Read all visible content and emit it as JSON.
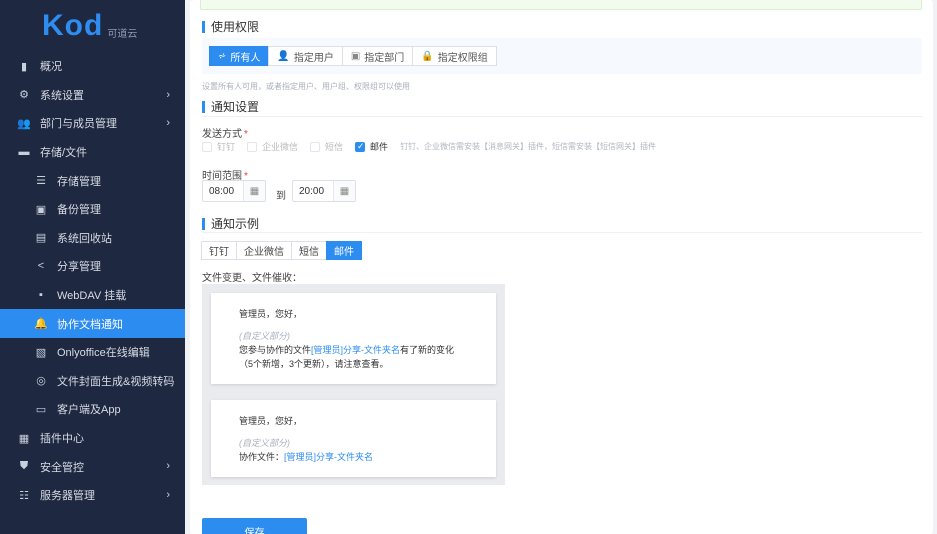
{
  "sidebar": {
    "brand": "Kod",
    "brand_sub": "可道云",
    "items": [
      {
        "label": "概况",
        "icon": "bar-chart-icon",
        "child": false,
        "chevron": false
      },
      {
        "label": "系统设置",
        "icon": "gear-icon",
        "child": false,
        "chevron": true
      },
      {
        "label": "部门与成员管理",
        "icon": "users-icon",
        "child": false,
        "chevron": true
      },
      {
        "label": "存储/文件",
        "icon": "folder-icon",
        "child": false,
        "chevron": false
      },
      {
        "label": "存储管理",
        "icon": "database-icon",
        "child": true,
        "chevron": false
      },
      {
        "label": "备份管理",
        "icon": "save-icon",
        "child": true,
        "chevron": false
      },
      {
        "label": "系统回收站",
        "icon": "trash-icon",
        "child": true,
        "chevron": false
      },
      {
        "label": "分享管理",
        "icon": "share-icon",
        "child": true,
        "chevron": false
      },
      {
        "label": "WebDAV 挂载",
        "icon": "drive-icon",
        "child": true,
        "chevron": false
      },
      {
        "label": "协作文档通知",
        "icon": "bell-icon",
        "child": true,
        "chevron": false,
        "active": true
      },
      {
        "label": "Onlyoffice在线编辑",
        "icon": "doc-edit-icon",
        "child": true,
        "chevron": false
      },
      {
        "label": "文件封面生成&视频转码",
        "icon": "media-icon",
        "child": true,
        "chevron": false
      },
      {
        "label": "客户端及App",
        "icon": "monitor-icon",
        "child": true,
        "chevron": false
      },
      {
        "label": "插件中心",
        "icon": "grid-icon",
        "child": false,
        "chevron": false
      },
      {
        "label": "安全管控",
        "icon": "shield-icon",
        "child": false,
        "chevron": true
      },
      {
        "label": "服务器管理",
        "icon": "server-icon",
        "child": false,
        "chevron": true
      }
    ]
  },
  "permission": {
    "title": "使用权限",
    "buttons": [
      "所有人",
      "指定用户",
      "指定部门",
      "指定权限组"
    ],
    "hint": "设置所有人可用，或者指定用户、用户组、权限组可以使用"
  },
  "notify": {
    "title": "通知设置",
    "method_label": "发送方式",
    "options": [
      {
        "label": "钉钉",
        "checked": false
      },
      {
        "label": "企业微信",
        "checked": false
      },
      {
        "label": "短信",
        "checked": false
      },
      {
        "label": "邮件",
        "checked": true
      }
    ],
    "options_note": "钉钉、企业微信需安装【消息网关】插件，短信需安装【短信网关】插件",
    "time_label": "时间范围",
    "time_from": "08:00",
    "time_to_label": "到",
    "time_to": "20:00"
  },
  "example": {
    "title": "通知示例",
    "tabs": [
      "钉钉",
      "企业微信",
      "短信",
      "邮件"
    ],
    "active_tab": "邮件",
    "label": "文件变更、文件催收：",
    "card1": {
      "greet": "管理员，您好，",
      "custom": "(自定义部分)",
      "line_prefix": "您参与协作的文件",
      "link": "[管理员]分享-文件夹名",
      "line_suffix": "有了新的变化",
      "line2": "（5个新增，3个更新），请注意查看。"
    },
    "card2": {
      "greet": "管理员，您好，",
      "custom": "(自定义部分)",
      "line_prefix": "协作文件：",
      "link": "[管理员]分享-文件夹名"
    }
  },
  "save_label": "保存",
  "colors": {
    "accent": "#2d8cf0",
    "sidebar_bg": "#1e2841",
    "required": "#e84040"
  }
}
